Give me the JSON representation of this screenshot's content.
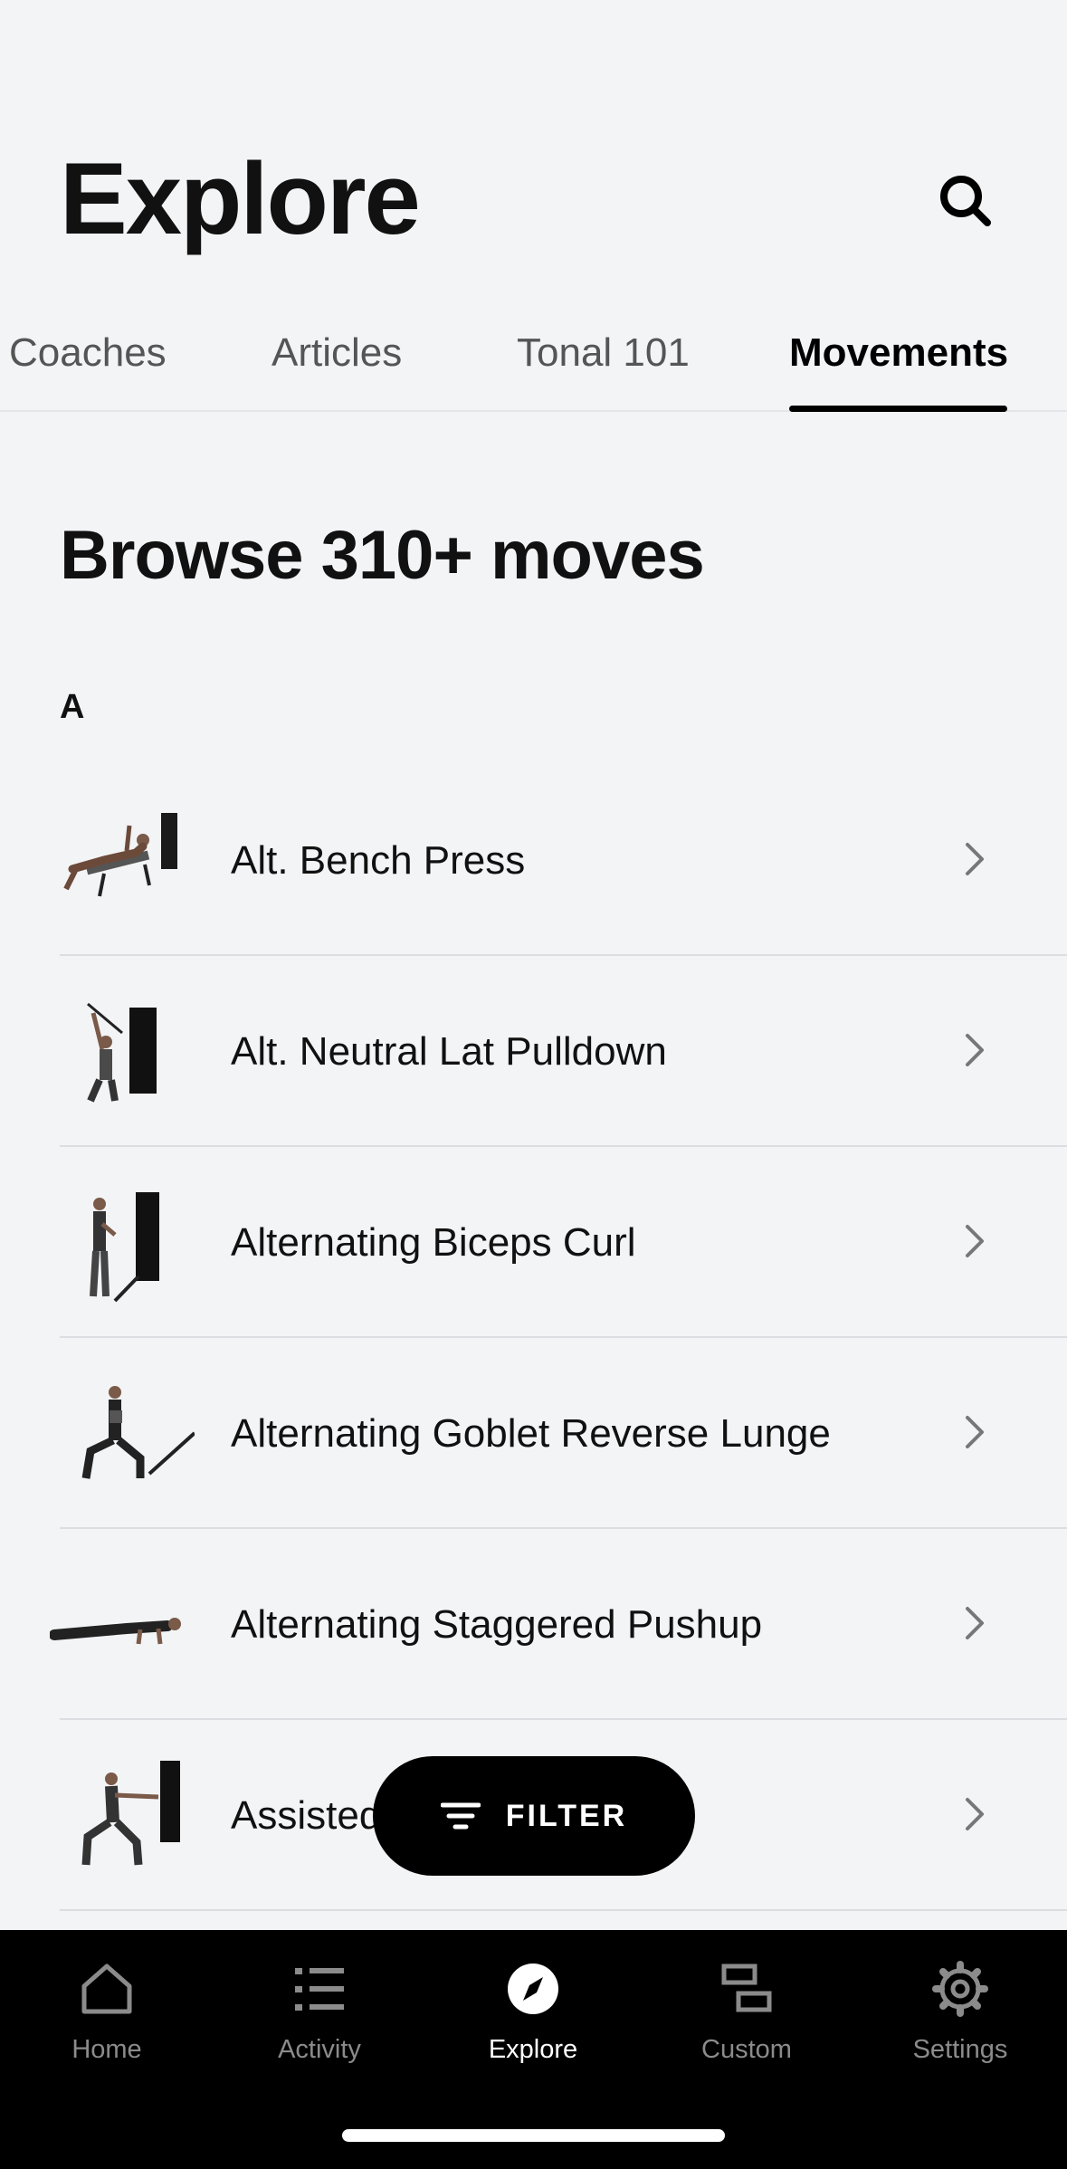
{
  "header": {
    "title": "Explore"
  },
  "tabs": [
    {
      "label": "Coaches"
    },
    {
      "label": "Articles"
    },
    {
      "label": "Tonal 101"
    },
    {
      "label": "Movements",
      "active": true
    }
  ],
  "section": {
    "title": "Browse 310+ moves",
    "letter": "A"
  },
  "movements": [
    {
      "name": "Alt. Bench Press"
    },
    {
      "name": "Alt. Neutral Lat Pulldown"
    },
    {
      "name": "Alternating Biceps Curl"
    },
    {
      "name": "Alternating Goblet Reverse Lunge"
    },
    {
      "name": "Alternating Staggered Pushup"
    },
    {
      "name": "Assisted"
    }
  ],
  "filter": {
    "label": "FILTER"
  },
  "tabbar": [
    {
      "label": "Home",
      "icon": "home-icon"
    },
    {
      "label": "Activity",
      "icon": "list-icon"
    },
    {
      "label": "Explore",
      "icon": "compass-icon",
      "active": true
    },
    {
      "label": "Custom",
      "icon": "custom-icon"
    },
    {
      "label": "Settings",
      "icon": "gear-icon"
    }
  ],
  "colors": {
    "background": "#f3f4f6",
    "accent": "#000000",
    "inactive": "#8b8b8b"
  }
}
